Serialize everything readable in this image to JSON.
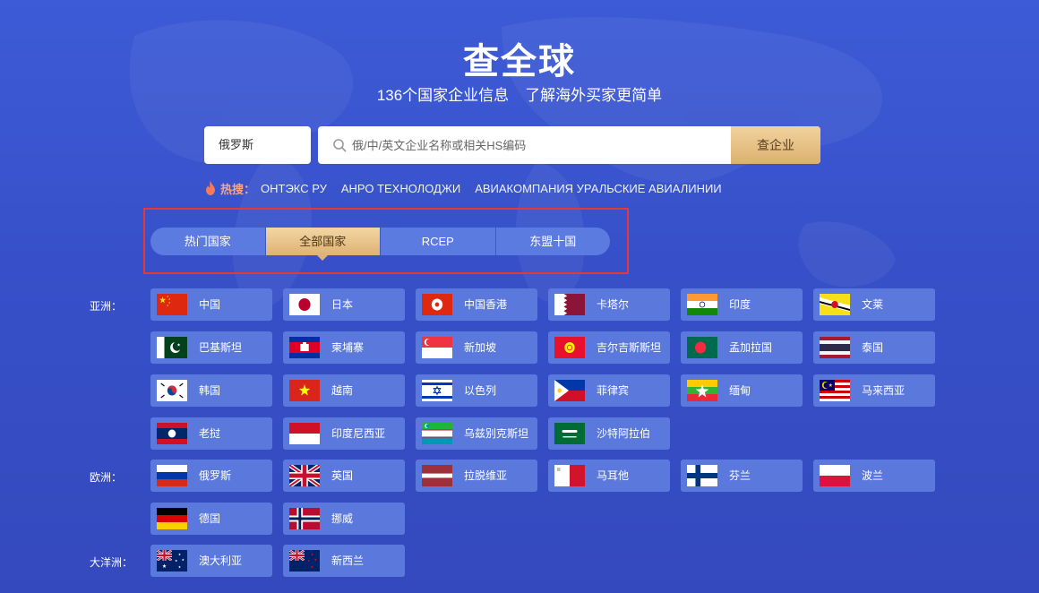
{
  "header": {
    "title": "查全球",
    "subtitle_part1": "136个国家企业信息",
    "subtitle_part2": "了解海外买家更简单"
  },
  "search": {
    "country_value": "俄罗斯",
    "placeholder": "俄/中/英文企业名称或相关HS编码",
    "button_label": "查企业"
  },
  "hot_search": {
    "label": "热搜：",
    "items": [
      "ОНТЭКС РУ",
      "АНРО ТЕХНОЛОДЖИ",
      "АВИАКОМПАНИЯ УРАЛЬСКИЕ АВИАЛИНИИ"
    ]
  },
  "tabs": [
    {
      "label": "热门国家",
      "active": false
    },
    {
      "label": "全部国家",
      "active": true
    },
    {
      "label": "RCEP",
      "active": false
    },
    {
      "label": "东盟十国",
      "active": false
    }
  ],
  "colors": {
    "accent_gold": "#dfb274",
    "highlight_border": "#e53935",
    "card_bg": "#5b79dc",
    "page_bg": "#3750c9"
  },
  "regions": [
    {
      "label": "亚洲：",
      "countries": [
        {
          "name": "中国",
          "flag": "china-flag-icon"
        },
        {
          "name": "日本",
          "flag": "japan-flag-icon"
        },
        {
          "name": "中国香港",
          "flag": "hongkong-flag-icon"
        },
        {
          "name": "卡塔尔",
          "flag": "qatar-flag-icon"
        },
        {
          "name": "印度",
          "flag": "india-flag-icon"
        },
        {
          "name": "文莱",
          "flag": "brunei-flag-icon"
        },
        {
          "name": "巴基斯坦",
          "flag": "pakistan-flag-icon"
        },
        {
          "name": "柬埔寨",
          "flag": "cambodia-flag-icon"
        },
        {
          "name": "新加坡",
          "flag": "singapore-flag-icon"
        },
        {
          "name": "吉尔吉斯斯坦",
          "flag": "kyrgyzstan-flag-icon"
        },
        {
          "name": "孟加拉国",
          "flag": "bangladesh-flag-icon"
        },
        {
          "name": "泰国",
          "flag": "thailand-flag-icon"
        },
        {
          "name": "韩国",
          "flag": "korea-flag-icon"
        },
        {
          "name": "越南",
          "flag": "vietnam-flag-icon"
        },
        {
          "name": "以色列",
          "flag": "israel-flag-icon"
        },
        {
          "name": "菲律宾",
          "flag": "philippines-flag-icon"
        },
        {
          "name": "缅甸",
          "flag": "myanmar-flag-icon"
        },
        {
          "name": "马来西亚",
          "flag": "malaysia-flag-icon"
        },
        {
          "name": "老挝",
          "flag": "laos-flag-icon"
        },
        {
          "name": "印度尼西亚",
          "flag": "indonesia-flag-icon"
        },
        {
          "name": "乌兹别克斯坦",
          "flag": "uzbekistan-flag-icon"
        },
        {
          "name": "沙特阿拉伯",
          "flag": "saudi-flag-icon"
        }
      ]
    },
    {
      "label": "欧洲：",
      "countries": [
        {
          "name": "俄罗斯",
          "flag": "russia-flag-icon"
        },
        {
          "name": "英国",
          "flag": "uk-flag-icon"
        },
        {
          "name": "拉脱维亚",
          "flag": "latvia-flag-icon"
        },
        {
          "name": "马耳他",
          "flag": "malta-flag-icon"
        },
        {
          "name": "芬兰",
          "flag": "finland-flag-icon"
        },
        {
          "name": "波兰",
          "flag": "poland-flag-icon"
        },
        {
          "name": "德国",
          "flag": "germany-flag-icon"
        },
        {
          "name": "挪威",
          "flag": "norway-flag-icon"
        }
      ]
    },
    {
      "label": "大洋洲：",
      "countries": [
        {
          "name": "澳大利亚",
          "flag": "australia-flag-icon"
        },
        {
          "name": "新西兰",
          "flag": "newzealand-flag-icon"
        }
      ]
    }
  ]
}
